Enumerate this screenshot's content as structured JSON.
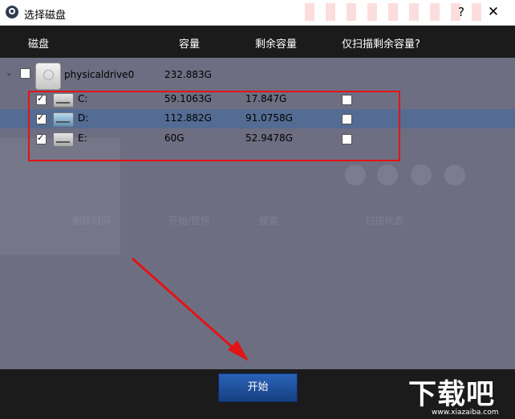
{
  "window": {
    "title": "选择磁盘",
    "help_label": "?",
    "close_label": "✕"
  },
  "header": {
    "col_disk": "磁盘",
    "col_capacity": "容量",
    "col_remaining": "剩余容量",
    "col_scan_remaining": "仅扫描剩余容量?"
  },
  "tree": {
    "physical": {
      "name": "physicaldrive0",
      "capacity": "232.883G",
      "checked": false,
      "expanded": true
    },
    "drives": [
      {
        "label": "C:",
        "capacity": "59.1063G",
        "remaining": "17.847G",
        "checked": true,
        "scan_remaining": false,
        "icon": "drive-icon"
      },
      {
        "label": "D:",
        "capacity": "112.882G",
        "remaining": "91.0758G",
        "checked": true,
        "scan_remaining": false,
        "icon": "drive-icon",
        "selected": true
      },
      {
        "label": "E:",
        "capacity": "60G",
        "remaining": "52.9478G",
        "checked": true,
        "scan_remaining": false,
        "icon": "drive-icon"
      }
    ]
  },
  "background_ghost": {
    "labels": [
      "删除时间",
      "开始/暂停",
      "搜索",
      "扫描状态"
    ]
  },
  "footer": {
    "start_label": "开始"
  },
  "watermark": {
    "text_cn": "下载吧",
    "url": "www.xiazaiba.com"
  },
  "colors": {
    "header_bg": "#1b1b1b",
    "panel_bg": "#6e6e82",
    "selected_row": "#546c93",
    "highlight_border": "#e21414",
    "button_bg": "#1f4f9a"
  }
}
